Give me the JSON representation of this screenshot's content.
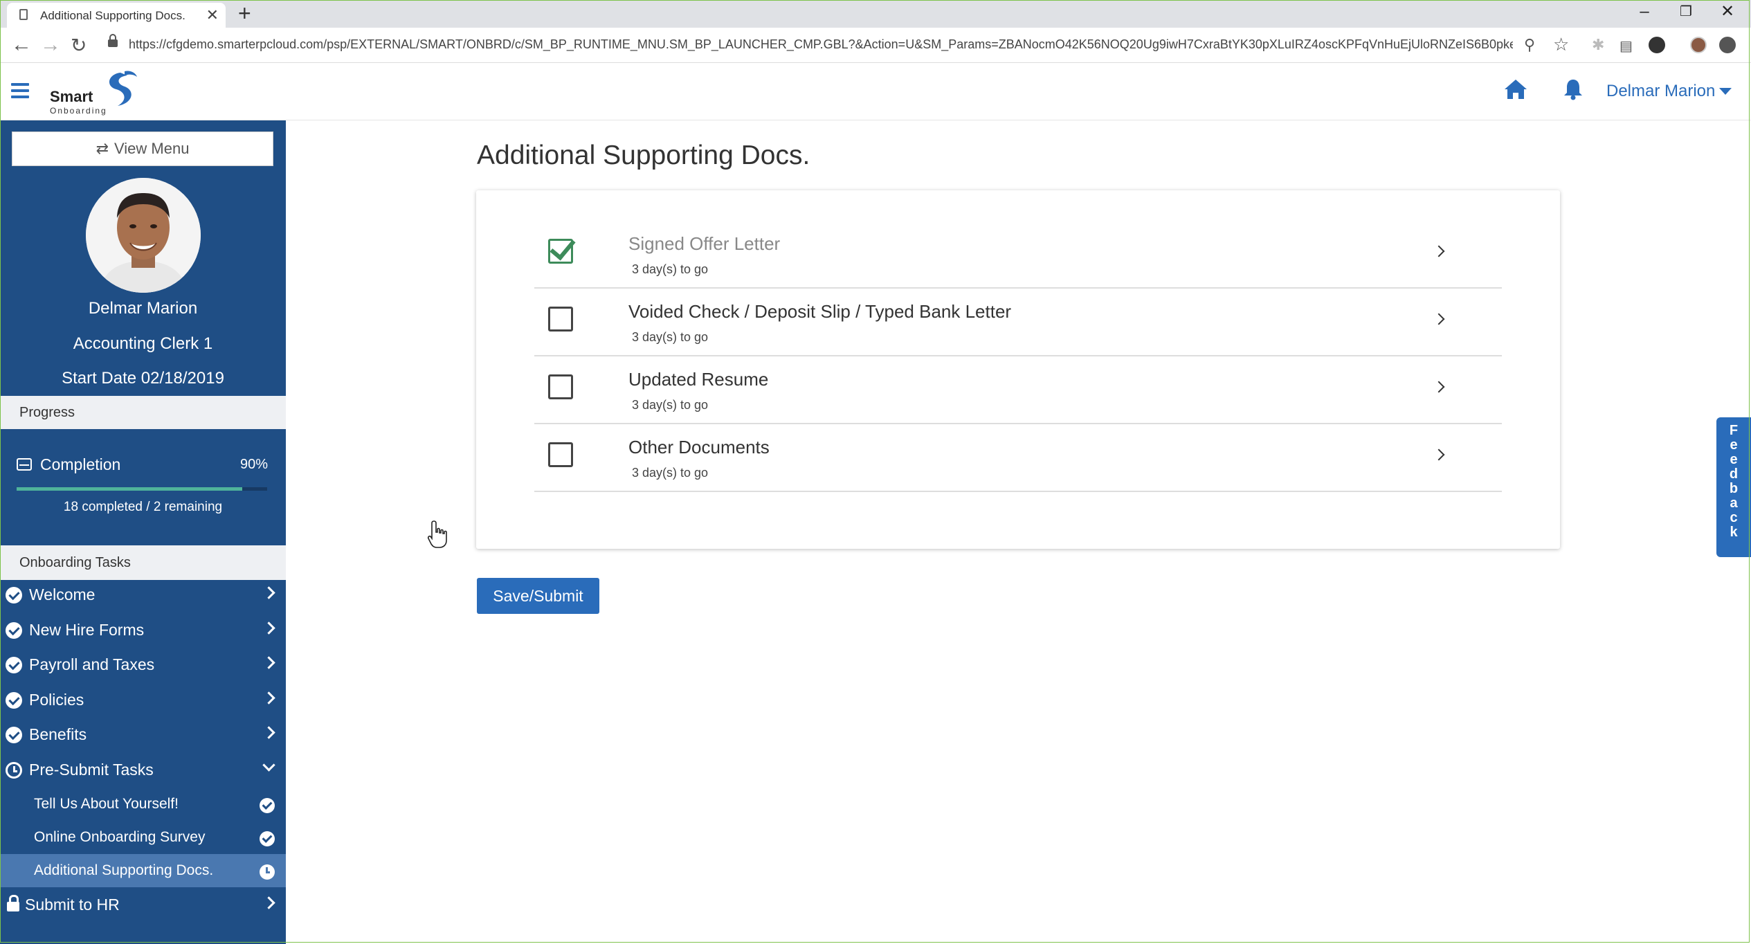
{
  "browser": {
    "tab_title": "Additional Supporting Docs.",
    "tab_close": "✕",
    "new_tab": "+",
    "url": "https://cfgdemo.smarterpcloud.com/psp/EXTERNAL/SMART/ONBRD/c/SM_BP_RUNTIME_MNU.SM_BP_LAUNCHER_CMP.GBL?&Action=U&SM_Params=ZBANocmO42K56NOQ20Ug9iwH7CxraBtYK30pXLuIRZ4oscKPFqVnHuEjUloRNZeIS6B0pkens...",
    "window_controls": [
      "–",
      "❐",
      "✕"
    ],
    "icons": [
      "back-icon",
      "forward-icon",
      "reload-icon",
      "zoom-icon",
      "star-icon",
      "extension-icon",
      "profile-icon"
    ]
  },
  "header": {
    "logo_word": "Smart",
    "logo_sub": "Onboarding",
    "user_name": "Delmar Marion",
    "colors": {
      "accent": "#2a6cba",
      "sidebar": "#1f4e85"
    }
  },
  "sidebar": {
    "view_menu_label": "View Menu",
    "employee_name": "Delmar Marion",
    "employee_title": "Accounting Clerk 1",
    "start_date": "Start Date 02/18/2019",
    "progress_heading": "Progress",
    "completion_label": "Completion",
    "completion_pct_text": "90%",
    "completion_fraction": 0.9,
    "progress_text": "18 completed / 2 remaining",
    "tasks_heading": "Onboarding Tasks",
    "tasks": [
      {
        "label": "Welcome",
        "status": "complete"
      },
      {
        "label": "New Hire Forms",
        "status": "complete"
      },
      {
        "label": "Payroll and Taxes",
        "status": "complete"
      },
      {
        "label": "Policies",
        "status": "complete"
      },
      {
        "label": "Benefits",
        "status": "complete"
      },
      {
        "label": "Pre-Submit Tasks",
        "status": "in-progress"
      }
    ],
    "subtasks": [
      {
        "label": "Tell Us About Yourself!",
        "status": "complete"
      },
      {
        "label": "Online Onboarding Survey",
        "status": "complete"
      },
      {
        "label": "Additional Supporting Docs.",
        "status": "in-progress"
      }
    ],
    "submit_label": "Submit to HR"
  },
  "main": {
    "title": "Additional Supporting Docs.",
    "documents": [
      {
        "title": "Signed Offer Letter",
        "due": "3 day(s) to go",
        "checked": true
      },
      {
        "title": "Voided Check / Deposit Slip / Typed Bank Letter",
        "due": "3 day(s) to go",
        "checked": false
      },
      {
        "title": "Updated Resume",
        "due": "3 day(s) to go",
        "checked": false
      },
      {
        "title": "Other Documents",
        "due": "3 day(s) to go",
        "checked": false
      }
    ],
    "save_label": "Save/Submit"
  },
  "feedback": {
    "label": "Feedback"
  }
}
